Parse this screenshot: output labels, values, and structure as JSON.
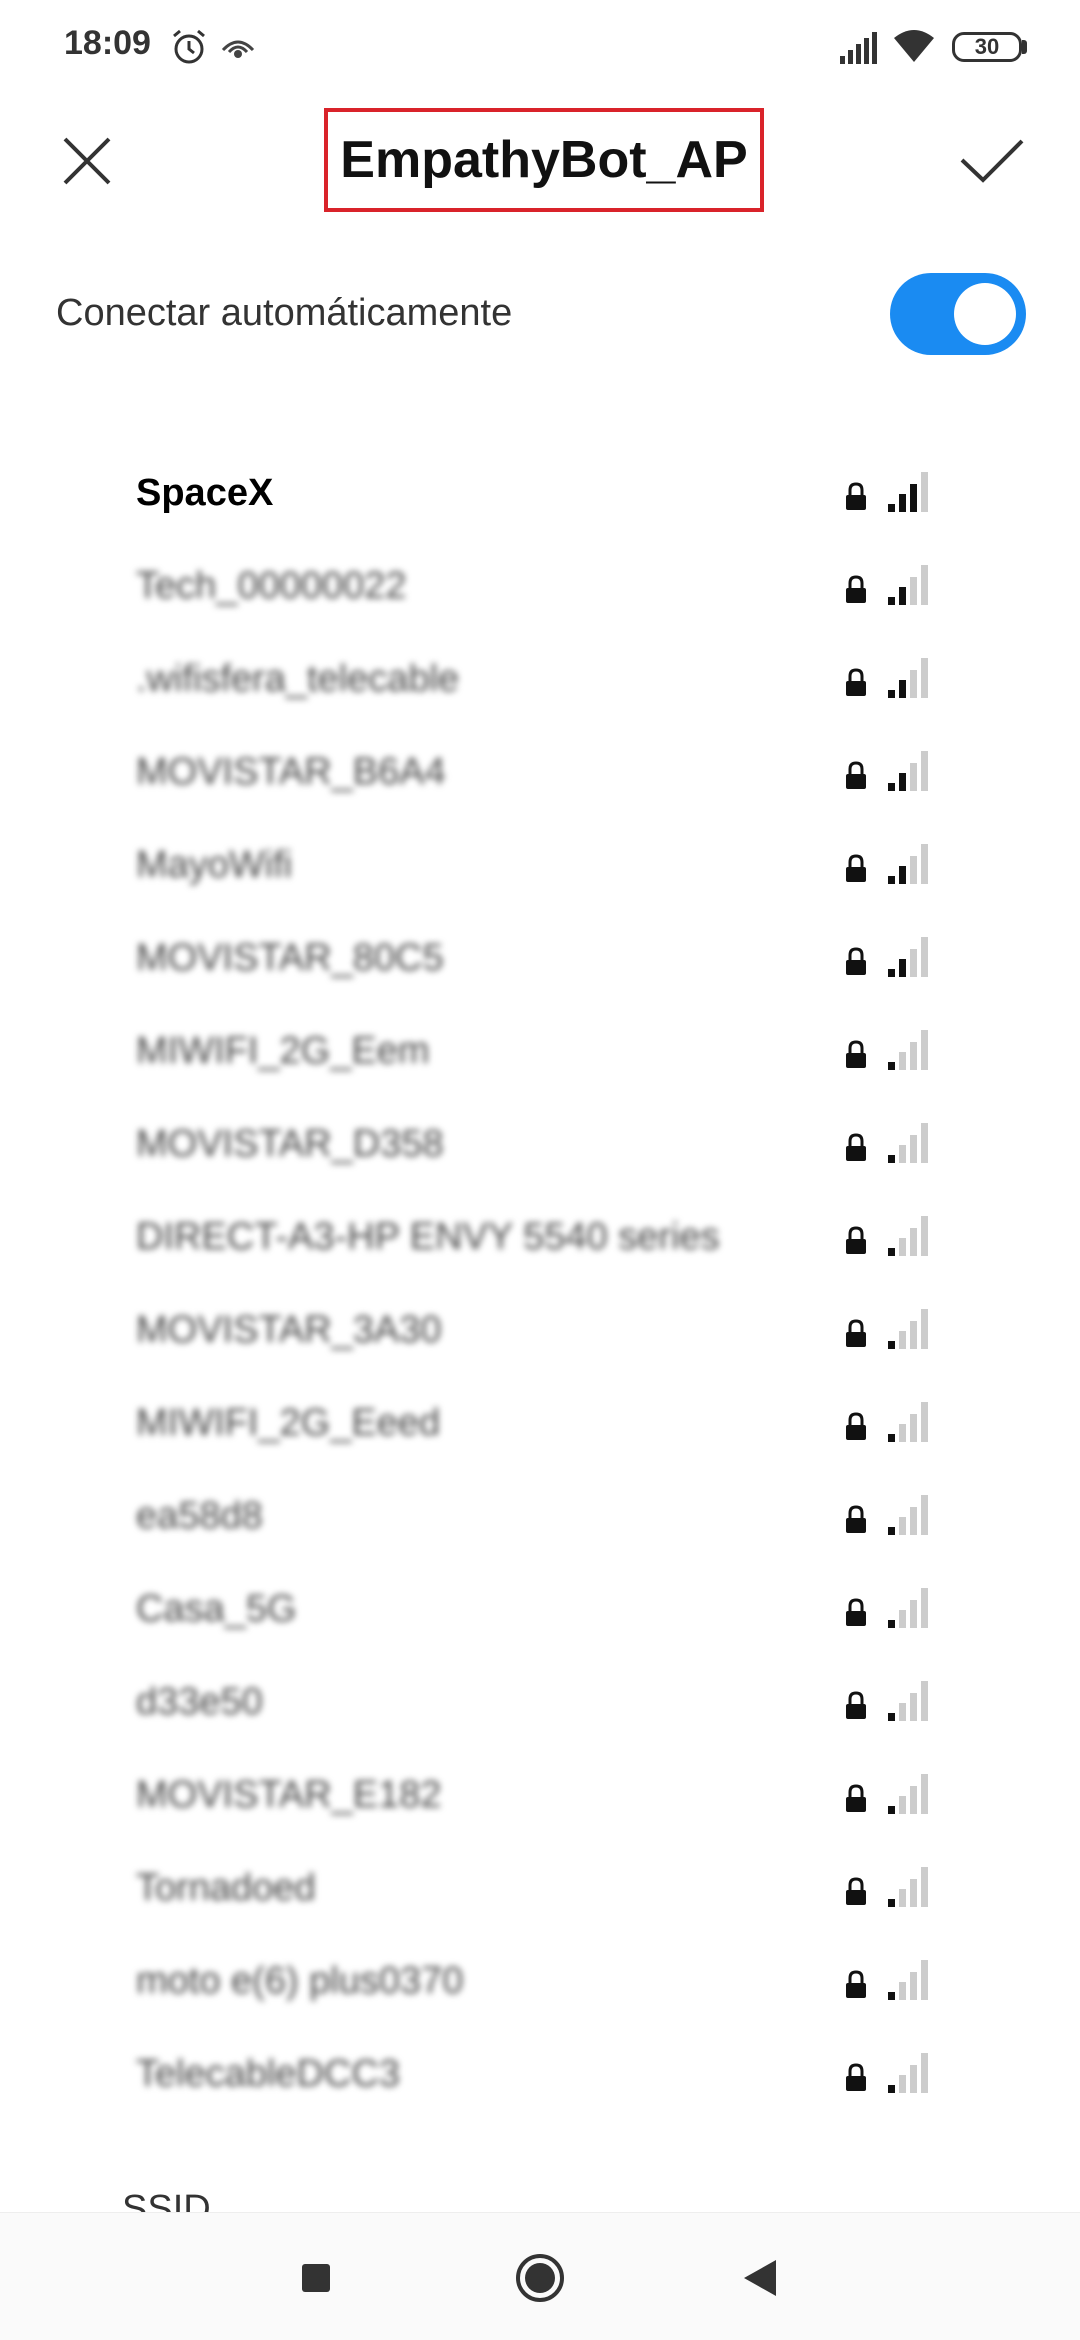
{
  "status_bar": {
    "time": "18:09",
    "battery": "30",
    "icons": [
      "alarm-icon",
      "eye-icon",
      "cell-signal-icon",
      "wifi-icon",
      "battery-icon"
    ]
  },
  "header": {
    "title": "EmpathyBot_AP",
    "close_icon": "close-icon",
    "confirm_icon": "check-icon",
    "highlight_color": "#d9232a"
  },
  "auto_connect": {
    "label": "Conectar automáticamente",
    "enabled": true,
    "accent": "#1a8bf2"
  },
  "networks": [
    {
      "name": "SpaceX",
      "bars": 3,
      "blurred": false
    },
    {
      "name": "Tech_00000022",
      "bars": 2,
      "blurred": true
    },
    {
      "name": ".wifisfera_telecable",
      "bars": 2,
      "blurred": true
    },
    {
      "name": "MOVISTAR_B6A4",
      "bars": 2,
      "blurred": true
    },
    {
      "name": "MayoWifi",
      "bars": 2,
      "blurred": true
    },
    {
      "name": "MOVISTAR_80C5",
      "bars": 2,
      "blurred": true
    },
    {
      "name": "MIWIFI_2G_Eem",
      "bars": 1,
      "blurred": true
    },
    {
      "name": "MOVISTAR_D358",
      "bars": 1,
      "blurred": true
    },
    {
      "name": "DIRECT-A3-HP ENVY 5540 series",
      "bars": 1,
      "blurred": true
    },
    {
      "name": "MOVISTAR_3A30",
      "bars": 1,
      "blurred": true
    },
    {
      "name": "MIWIFI_2G_Eeed",
      "bars": 1,
      "blurred": true
    },
    {
      "name": "ea58d8",
      "bars": 1,
      "blurred": true
    },
    {
      "name": "Casa_5G",
      "bars": 1,
      "blurred": true
    },
    {
      "name": "d33e50",
      "bars": 1,
      "blurred": true
    },
    {
      "name": "MOVISTAR_E182",
      "bars": 1,
      "blurred": true
    },
    {
      "name": "Tornadoed",
      "bars": 1,
      "blurred": true
    },
    {
      "name": "moto e(6) plus0370",
      "bars": 1,
      "blurred": true
    },
    {
      "name": "TelecableDCC3",
      "bars": 1,
      "blurred": true
    }
  ],
  "ssid_label": "SSID",
  "nav": {
    "recent_icon": "square-icon",
    "home_icon": "circle-icon",
    "back_icon": "triangle-back-icon"
  }
}
